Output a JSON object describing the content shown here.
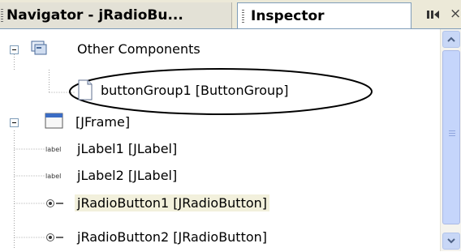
{
  "tabs": [
    {
      "label": "Navigator - jRadioBu...",
      "active": false
    },
    {
      "label": "Inspector",
      "active": true
    }
  ],
  "window_controls": {
    "minimize_icon": "minimize-icon",
    "close_label": "×"
  },
  "tree": {
    "other_components": {
      "label": "Other Components",
      "icon": "components-folder-icon",
      "children": [
        {
          "label": "buttonGroup1 [ButtonGroup]",
          "icon": "document-icon",
          "circled": true
        }
      ]
    },
    "frame": {
      "label": "[JFrame]",
      "icon": "frame-icon",
      "children": [
        {
          "label": "jLabel1 [JLabel]",
          "icon": "label-icon"
        },
        {
          "label": "jLabel2 [JLabel]",
          "icon": "label-icon"
        },
        {
          "label": "jRadioButton1 [JRadioButton]",
          "icon": "radio-button-icon",
          "selected": true
        },
        {
          "label": "jRadioButton2 [JRadioButton]",
          "icon": "radio-button-icon"
        }
      ]
    }
  },
  "colors": {
    "tab_border": "#7f9db9",
    "selection": "#f2f0dc",
    "scrollbar_thumb": "#c5d5fb",
    "annotation": "#000000"
  }
}
